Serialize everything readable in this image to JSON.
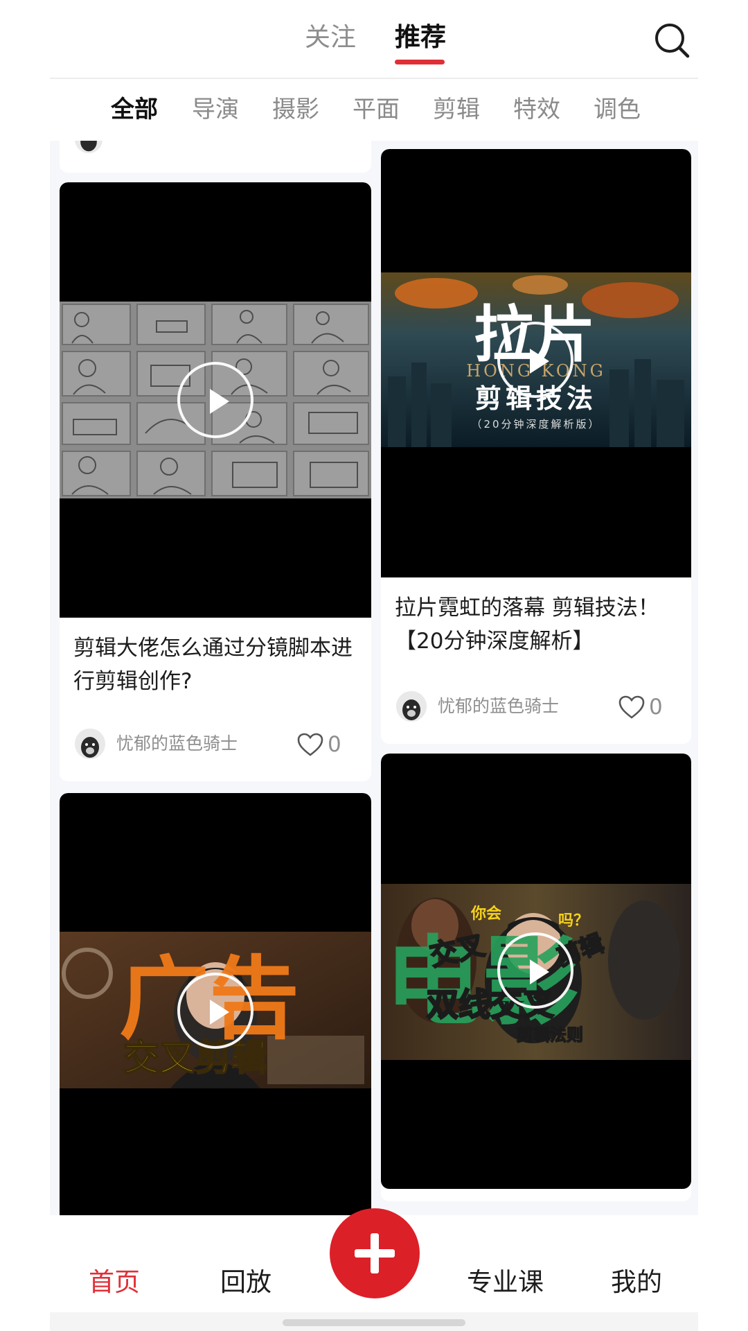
{
  "top_tabs": [
    {
      "label": "关注",
      "active": false
    },
    {
      "label": "推荐",
      "active": true
    }
  ],
  "search_icon": "search-icon",
  "categories": [
    {
      "label": "全部",
      "active": true
    },
    {
      "label": "导演",
      "active": false
    },
    {
      "label": "摄影",
      "active": false
    },
    {
      "label": "平面",
      "active": false
    },
    {
      "label": "剪辑",
      "active": false
    },
    {
      "label": "特效",
      "active": false
    },
    {
      "label": "调色",
      "active": false
    }
  ],
  "cards": [
    {
      "title": "剪辑大佬怎么通过分镜脚本进行剪辑创作?",
      "author": "忧郁的蓝色骑士",
      "likes": "0"
    },
    {
      "title": "拉片霓虹的落幕 剪辑技法！【20分钟深度解析】",
      "author": "忧郁的蓝色骑士",
      "likes": "0",
      "thumb_text": {
        "big": "拉片",
        "sub": "HONG KONG",
        "main": "剪辑技法",
        "small": "（20分钟深度解析版）"
      }
    },
    {
      "title": "",
      "thumb_text": {
        "big": "广告",
        "main": "交叉剪辑"
      }
    },
    {
      "title": "",
      "thumb_text": {
        "big": "电影",
        "ask": "你会",
        "q": "吗？",
        "main": "双线交叉",
        "small": "剪辑法则",
        "v1": "交叉",
        "v2": "剪辑"
      }
    }
  ],
  "bottom_nav": [
    {
      "label": "首页",
      "active": true
    },
    {
      "label": "回放",
      "active": false
    },
    {
      "label": "专业课",
      "active": false
    },
    {
      "label": "我的",
      "active": false
    }
  ],
  "colors": {
    "accent": "#e02f36",
    "feed_bg": "#f6f7fb"
  }
}
